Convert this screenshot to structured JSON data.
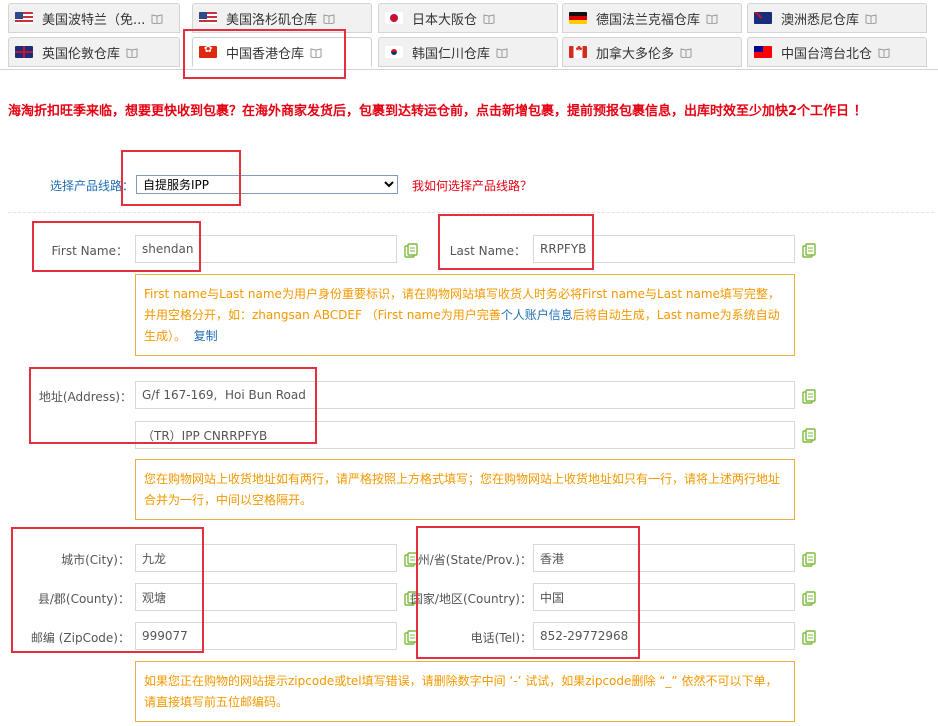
{
  "tabs": [
    {
      "label": "美国波特兰（免...",
      "flag": "f-us"
    },
    {
      "label": "美国洛杉矶仓库",
      "flag": "f-us"
    },
    {
      "label": "日本大阪仓",
      "flag": "f-jp"
    },
    {
      "label": "德国法兰克福仓库",
      "flag": "f-de"
    },
    {
      "label": "澳洲悉尼仓库",
      "flag": "f-au"
    },
    {
      "label": "英国伦敦仓库",
      "flag": "f-gb"
    },
    {
      "label": "中国香港仓库",
      "flag": "f-hk"
    },
    {
      "label": "韩国仁川仓库",
      "flag": "f-kr"
    },
    {
      "label": "加拿大多伦多",
      "flag": "f-ca"
    },
    {
      "label": "中国台湾台北仓",
      "flag": "f-tw"
    }
  ],
  "active_tab": "中国香港仓库",
  "notice": "海淘折扣旺季来临，想要更快收到包裹？在海外商家发货后，包裹到达转运仓前，点击新增包裹，提前预报包裹信息，出库时效至少加快2个工作日 ！",
  "product_line": {
    "label": "选择产品线路：",
    "selected": "自提服务IPP",
    "help_link": "我如何选择产品线路？"
  },
  "name": {
    "first_label": "First Name：",
    "first_value": "shendan",
    "last_label": "Last Name：",
    "last_value": "RRPFYB",
    "hint_part1": "First name与Last name为用户身份重要标识，请在购物网站填写收货人时务必将First name与Last name填写完整，并用空格分开，如：zhangsan ABCDEF （First name为用户完善",
    "hint_link": "个人账户信息",
    "hint_part2": "后将自动生成，Last name为系统自动生成）。",
    "hint_copy": "复制"
  },
  "address": {
    "label": "地址(Address)：",
    "line1": "G/f 167-169,  Hoi Bun Road",
    "line2": "（TR）IPP CNRRPFYB",
    "hint": "您在购物网站上收货地址如有两行，请严格按照上方格式填写；您在购物网站上收货地址如只有一行，请将上述两行地址合并为一行，中间以空格隔开。"
  },
  "location": {
    "city_label": "城市(City)：",
    "city_value": "九龙",
    "county_label": "县/郡(County)：",
    "county_value": "观塘",
    "zip_label": "邮编 (ZipCode)：",
    "zip_value": "999077",
    "state_label": "州/省(State/Prov.)：",
    "state_value": "香港",
    "country_label": "国家/地区(Country)：",
    "country_value": "中国",
    "tel_label": "电话(Tel)：",
    "tel_value": "852-29772968",
    "hint": "如果您正在购物的网站提示zipcode或tel填写错误，请删除数字中间 ‘-’ 试试，如果zipcode删除 “_” 依然不可以下单，请直接填写前五位邮编码。"
  },
  "colors": {
    "accent_red": "#e60012",
    "highlight_box": "#e52e3e",
    "hint_text": "#f39800",
    "hint_border": "#e6b13f",
    "link_blue": "#1f6fb5",
    "copy_icon": "#7dbb3c"
  }
}
